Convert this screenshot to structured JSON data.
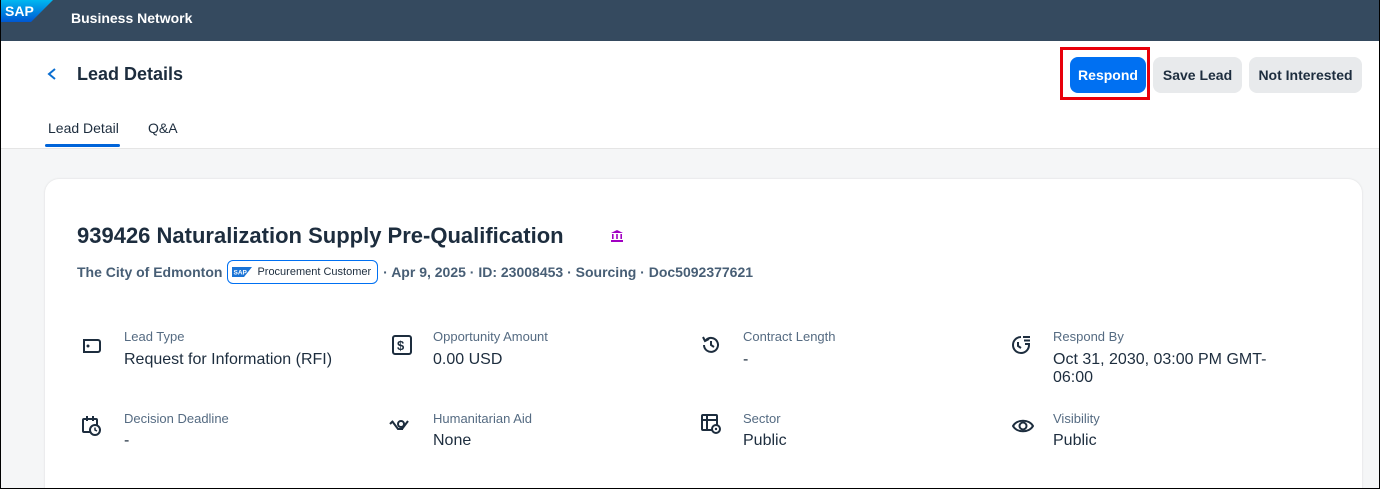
{
  "shell": {
    "brand": "SAP",
    "title": "Business Network"
  },
  "header": {
    "title": "Lead Details",
    "buttons": {
      "respond": "Respond",
      "save": "Save Lead",
      "not_interested": "Not Interested"
    },
    "tabs": [
      {
        "label": "Lead Detail"
      },
      {
        "label": "Q&A"
      }
    ]
  },
  "lead": {
    "title": "939426 Naturalization Supply Pre-Qualification",
    "buyer": "The City of Edmonton",
    "badge": "Procurement Customer",
    "badge_logo": "SAP",
    "meta": "· Apr 9, 2025 · ID: 23008453 · Sourcing · Doc5092377621",
    "fields": [
      {
        "icon": "tag-icon",
        "label": "Lead Type",
        "value": "Request for Information (RFI)"
      },
      {
        "icon": "money-bill-icon",
        "label": "Opportunity Amount",
        "value": "0.00 USD"
      },
      {
        "icon": "history-icon",
        "label": "Contract Length",
        "value": "-"
      },
      {
        "icon": "clock-list-icon",
        "label": "Respond By",
        "value": "Oct 31, 2030, 03:00 PM GMT-06:00"
      },
      {
        "icon": "calendar-clock-icon",
        "label": "Decision Deadline",
        "value": "-"
      },
      {
        "icon": "hands-icon",
        "label": "Humanitarian Aid",
        "value": "None"
      },
      {
        "icon": "grid-gear-icon",
        "label": "Sector",
        "value": "Public"
      },
      {
        "icon": "eye-icon",
        "label": "Visibility",
        "value": "Public"
      }
    ]
  },
  "colors": {
    "shell": "#354a5f",
    "primary": "#0070f2",
    "highlight": "#e8000b",
    "bank_icon": "#a100c2"
  }
}
